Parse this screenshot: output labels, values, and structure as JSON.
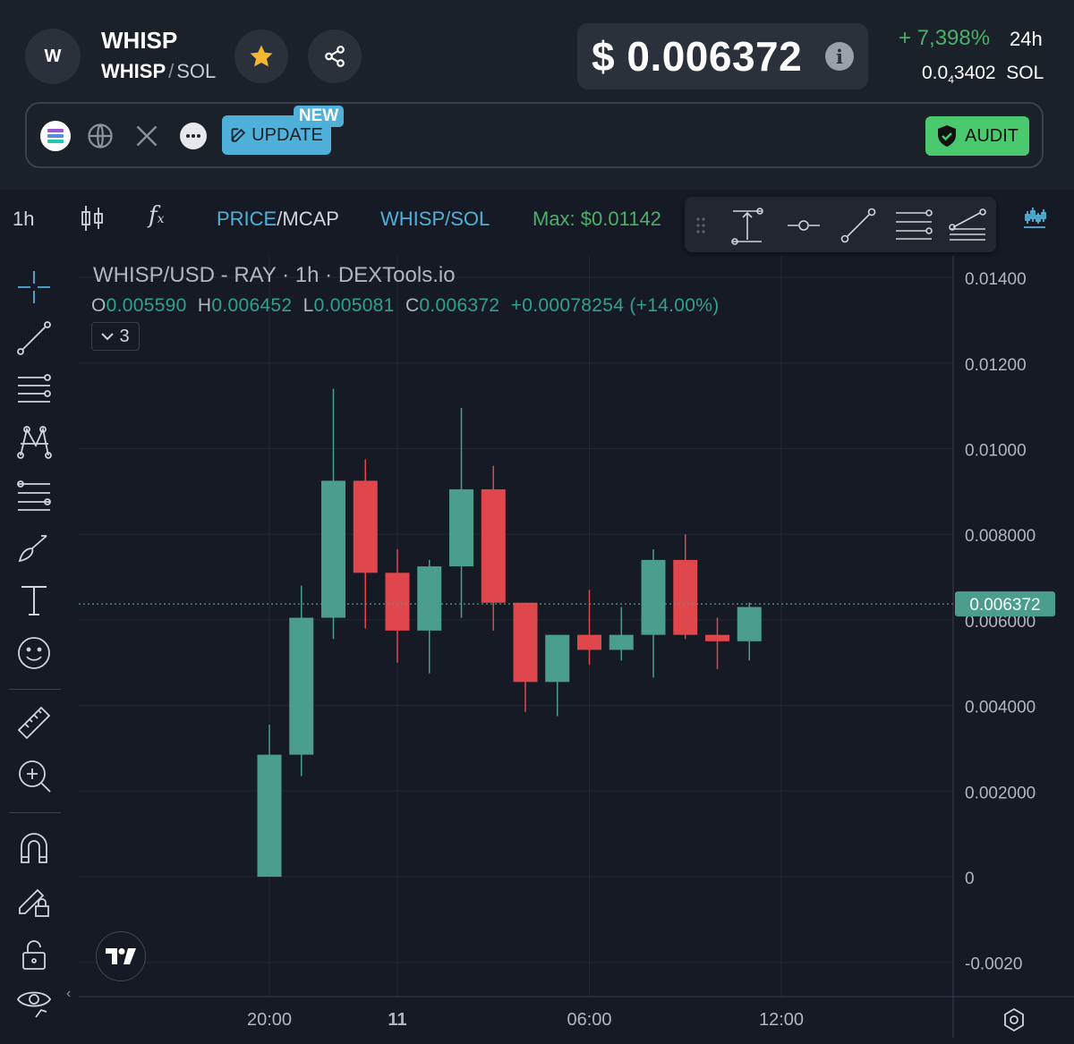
{
  "token": {
    "avatar_letter": "W",
    "name": "WHISP",
    "base": "WHISP",
    "separator": "/",
    "quote": "SOL"
  },
  "price": {
    "usd": "$ 0.006372",
    "change": "+ 7,398%",
    "period": "24h",
    "sol_prefix": "0.0",
    "sol_sub": "4",
    "sol_digits": "3402",
    "sol_unit": "SOL"
  },
  "links": {
    "update_label": "UPDATE",
    "new_badge": "NEW",
    "audit_label": "AUDIT",
    "icons": [
      "solana-icon",
      "globe-icon",
      "x-icon",
      "more-icon"
    ]
  },
  "toolbar": {
    "interval": "1h",
    "price_label": "PRICE",
    "slash": "/",
    "mcap_label": "MCAP",
    "pair_label": "WHISP/SOL",
    "max_label": "Max: $0.01142"
  },
  "chart_legend": {
    "title": "WHISP/USD - RAY · 1h · DEXTools.io",
    "o_label": "O",
    "o_value": "0.005590",
    "h_label": "H",
    "h_value": "0.006452",
    "l_label": "L",
    "l_value": "0.005081",
    "c_label": "C",
    "c_value": "0.006372",
    "change": "+0.00078254 (+14.00%)",
    "collapsed_count": "3"
  },
  "colors": {
    "up": "#4a9e8b",
    "down": "#e0474c",
    "accent_blue": "#4fb1d9",
    "green": "#4caf6a"
  },
  "chart_data": {
    "type": "candlestick",
    "title": "WHISP/USD - RAY · 1h · DEXTools.io",
    "interval": "1h",
    "ylim": [
      -0.0025,
      0.015
    ],
    "y_ticks": [
      -0.002,
      0,
      0.002,
      0.004,
      0.006,
      0.008,
      0.01,
      0.012,
      0.014
    ],
    "y_tick_labels": [
      "-0.0020",
      "0",
      "0.002000",
      "0.004000",
      "0.006000",
      "0.008000",
      "0.01000",
      "0.01200",
      "0.01400"
    ],
    "x_tick_labels": [
      {
        "label": "20:00",
        "hour": 20
      },
      {
        "label": "11",
        "hour": 24,
        "bold": true
      },
      {
        "label": "06:00",
        "hour": 30
      },
      {
        "label": "12:00",
        "hour": 36
      }
    ],
    "last_price": 0.006372,
    "last_price_label": "0.006372",
    "candles": [
      {
        "hour": 20,
        "o": 0.0,
        "h": 0.00355,
        "l": 0.0,
        "c": 0.00285
      },
      {
        "hour": 21,
        "o": 0.00285,
        "h": 0.0068,
        "l": 0.00235,
        "c": 0.00605
      },
      {
        "hour": 22,
        "o": 0.00605,
        "h": 0.0114,
        "l": 0.00555,
        "c": 0.00925
      },
      {
        "hour": 23,
        "o": 0.00925,
        "h": 0.00975,
        "l": 0.0058,
        "c": 0.0071
      },
      {
        "hour": 24,
        "o": 0.0071,
        "h": 0.00765,
        "l": 0.005,
        "c": 0.00575
      },
      {
        "hour": 25,
        "o": 0.00575,
        "h": 0.0074,
        "l": 0.00475,
        "c": 0.00725
      },
      {
        "hour": 26,
        "o": 0.00725,
        "h": 0.01095,
        "l": 0.00605,
        "c": 0.00905
      },
      {
        "hour": 27,
        "o": 0.00905,
        "h": 0.0096,
        "l": 0.00575,
        "c": 0.0064
      },
      {
        "hour": 28,
        "o": 0.0064,
        "h": 0.0064,
        "l": 0.00385,
        "c": 0.00455
      },
      {
        "hour": 29,
        "o": 0.00455,
        "h": 0.00565,
        "l": 0.00375,
        "c": 0.00565
      },
      {
        "hour": 30,
        "o": 0.00565,
        "h": 0.0067,
        "l": 0.00495,
        "c": 0.0053
      },
      {
        "hour": 31,
        "o": 0.0053,
        "h": 0.0063,
        "l": 0.00505,
        "c": 0.00565
      },
      {
        "hour": 32,
        "o": 0.00565,
        "h": 0.00765,
        "l": 0.00465,
        "c": 0.0074
      },
      {
        "hour": 33,
        "o": 0.0074,
        "h": 0.008,
        "l": 0.00555,
        "c": 0.00565
      },
      {
        "hour": 34,
        "o": 0.00565,
        "h": 0.00605,
        "l": 0.00485,
        "c": 0.0055
      },
      {
        "hour": 35,
        "o": 0.0055,
        "h": 0.0064,
        "l": 0.00505,
        "c": 0.0063
      }
    ]
  }
}
